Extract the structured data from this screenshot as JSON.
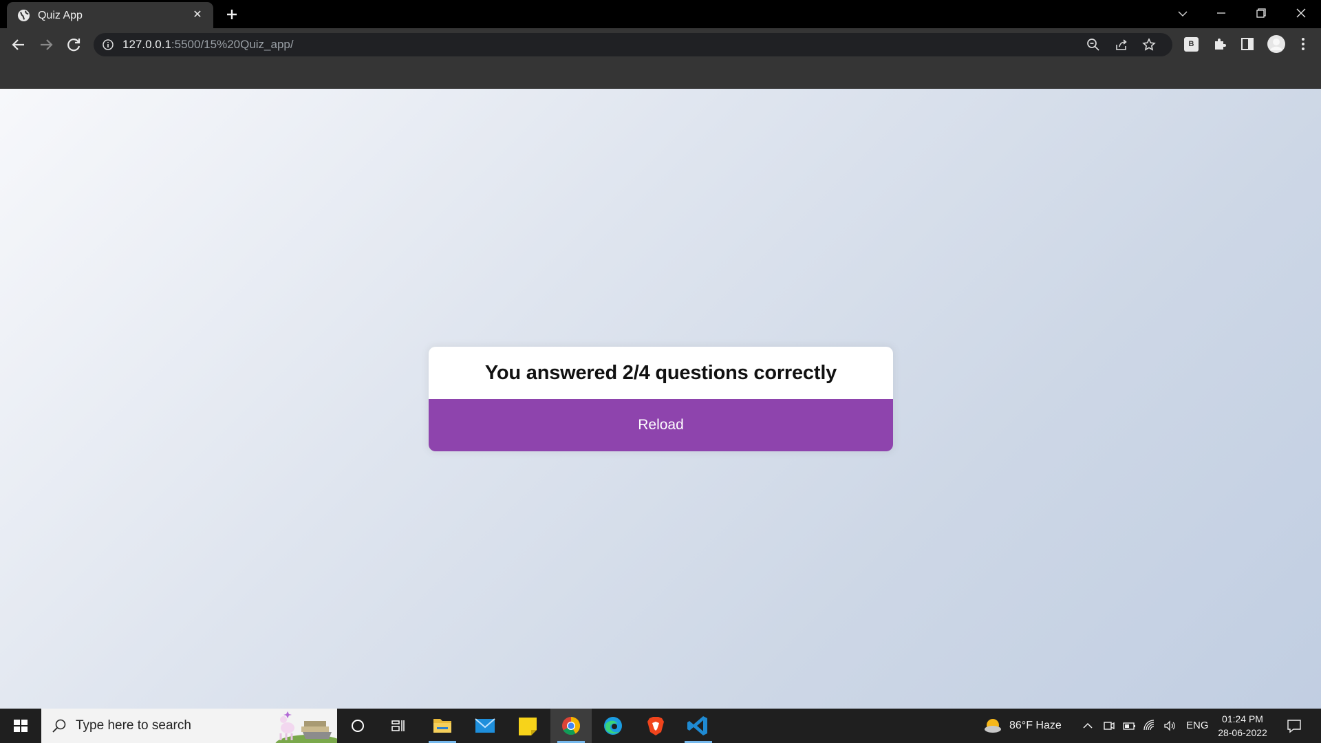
{
  "browser": {
    "tab_title": "Quiz App",
    "tab_close_glyph": "✕",
    "url_host": "127.0.0.1",
    "url_rest": ":5500/15%20Quiz_app/",
    "profile_extension_letter": "B"
  },
  "page": {
    "heading": "You answered 2/4 questions correctly",
    "reload_label": "Reload",
    "accent_color": "#8e44ad"
  },
  "taskbar": {
    "search_placeholder": "Type here to search",
    "weather": "86°F  Haze",
    "language": "ENG",
    "time": "01:24 PM",
    "date": "28-06-2022"
  }
}
